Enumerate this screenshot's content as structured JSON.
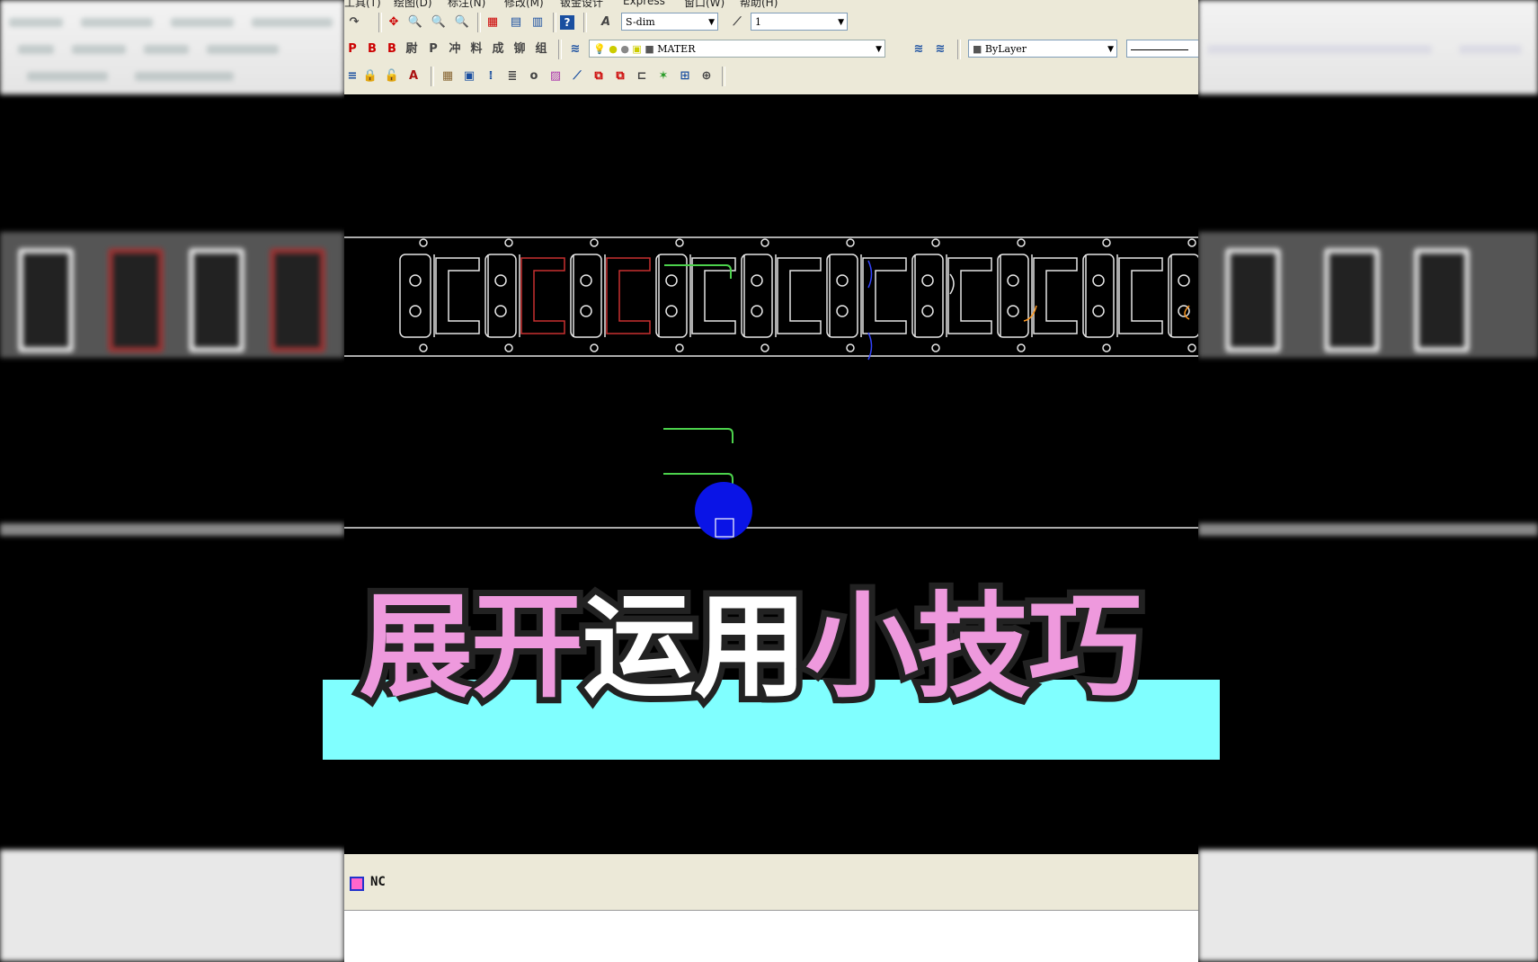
{
  "menubar": {
    "items": [
      "工具(T)",
      "绘图(D)",
      "标注(N)",
      "修改(M)",
      "钣金设计",
      "Express",
      "窗口(W)",
      "帮助(H)"
    ]
  },
  "toolbar": {
    "text_style": "S-dim",
    "dim_scale": "1",
    "layer": "MATER",
    "color": "ByLayer"
  },
  "status": {
    "nc_label": "NC"
  },
  "caption": {
    "part1": "展开",
    "part2": "运用",
    "part3": "小技巧"
  },
  "colors": {
    "caption_pink": "#ee99dd",
    "caption_band": "#80ffff",
    "canvas_bg": "#000000",
    "cursor_blob": "#0a14e6"
  },
  "icons": [
    "help-icon",
    "text-style-icon",
    "dim-style-icon",
    "layer-manager-icon",
    "lightbulb-icon",
    "sun-icon",
    "lock-icon",
    "color-swatch-icon",
    "nc-icon"
  ]
}
